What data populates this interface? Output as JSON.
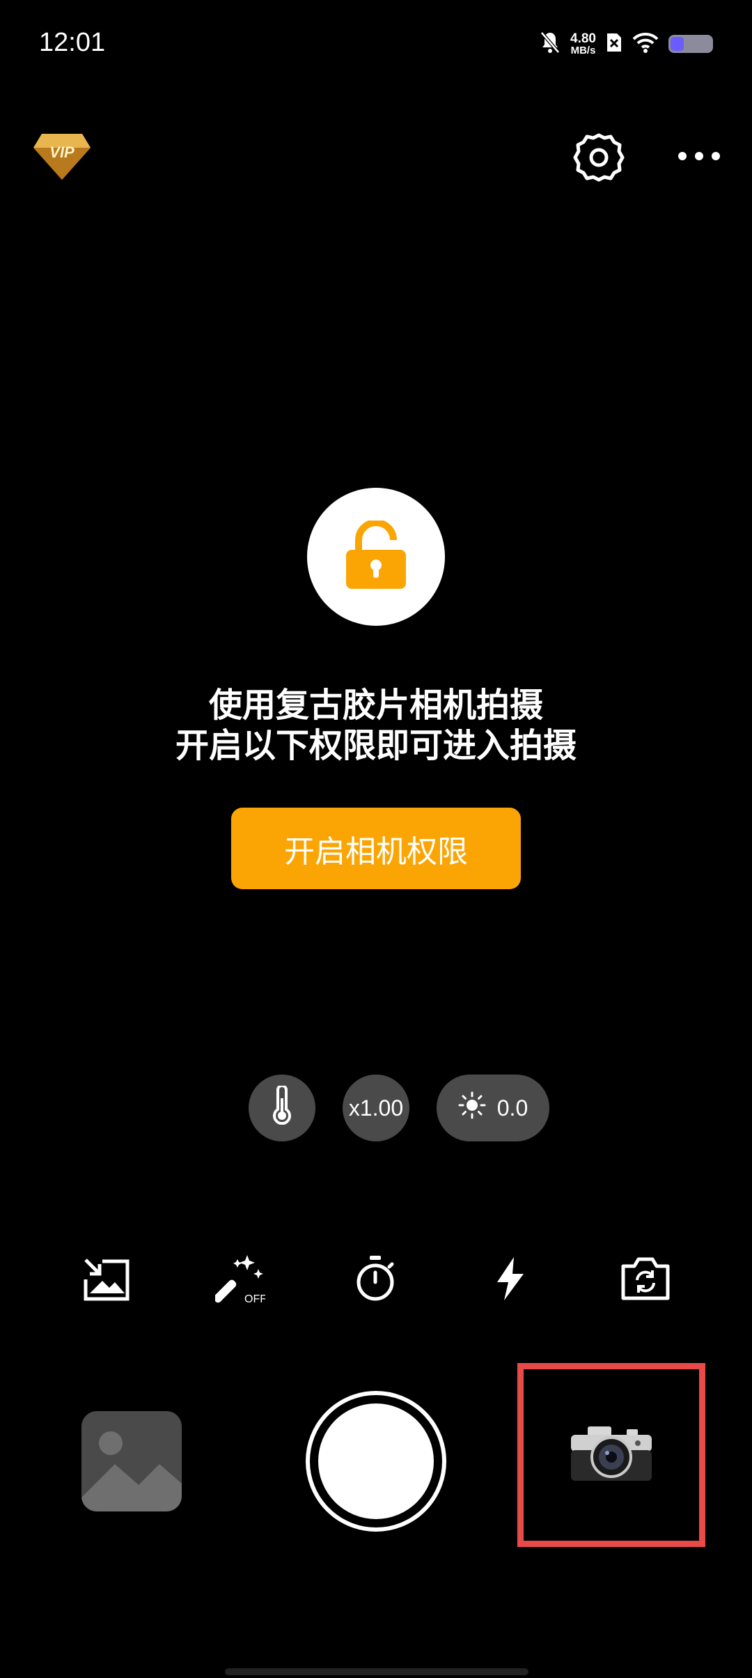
{
  "status_bar": {
    "time": "12:01",
    "net_speed_value": "4.80",
    "net_speed_unit": "MB/s",
    "icons": [
      "mute-bell-icon",
      "sim-x-icon",
      "wifi-icon",
      "battery-icon"
    ],
    "battery_level": 0.3
  },
  "top_bar": {
    "vip_label": "VIP",
    "icons": [
      "vip-badge-icon",
      "settings-icon",
      "more-icon"
    ]
  },
  "permission": {
    "line1": "使用复古胶片相机拍摄",
    "line2": "开启以下权限即可进入拍摄",
    "button_label": "开启相机权限",
    "accent_color": "#fba505"
  },
  "controls": {
    "zoom": "x1.00",
    "exposure": "0.0"
  },
  "tools": [
    "import-image-icon",
    "magic-wand-icon",
    "timer-icon",
    "flash-icon",
    "flip-camera-icon"
  ],
  "tools_magic_label": "OFF",
  "bottom": {
    "highlight_color": "#e84a4a"
  }
}
